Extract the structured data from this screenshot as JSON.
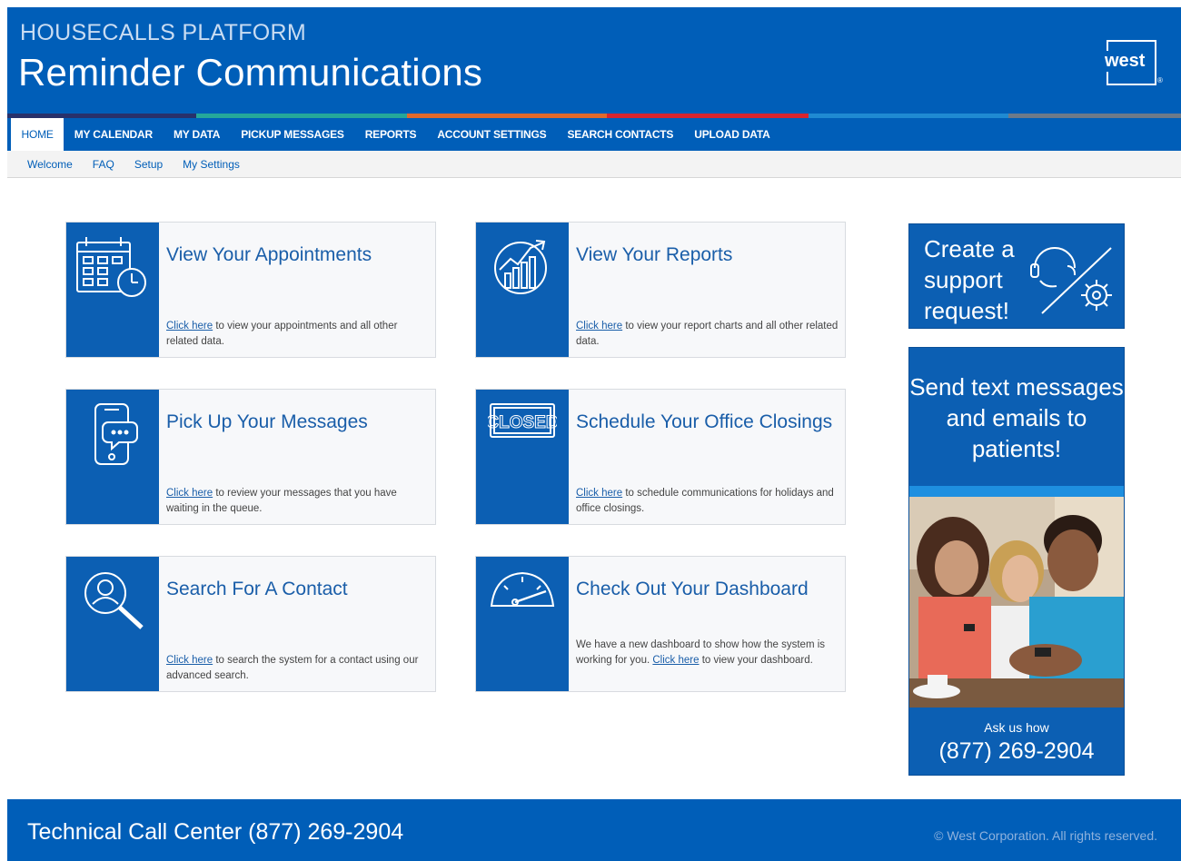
{
  "header": {
    "platform": "HOUSECALLS PLATFORM",
    "title": "Reminder Communications",
    "logo_text": "west",
    "logo_reg": "®"
  },
  "colors": {
    "brand_blue": "#005eb8",
    "card_blue": "#0c5fb3",
    "stripe": [
      "#28316b",
      "#25a79a",
      "#e1692c",
      "#d8252e",
      "#1f8ad2",
      "#6d7a89"
    ]
  },
  "nav": {
    "tabs": [
      "HOME",
      "MY CALENDAR",
      "MY DATA",
      "PICKUP MESSAGES",
      "REPORTS",
      "ACCOUNT SETTINGS",
      "SEARCH CONTACTS",
      "UPLOAD DATA"
    ],
    "active": "HOME",
    "subnav": [
      "Welcome",
      "FAQ",
      "Setup",
      "My Settings"
    ]
  },
  "cards": [
    {
      "icon": "calendar-clock-icon",
      "title": "View Your Appointments",
      "link": "Click here",
      "desc": " to view your appointments and all other related data."
    },
    {
      "icon": "report-chart-icon",
      "title": "View Your Reports",
      "link": "Click here",
      "desc": " to view your report charts and all other related data."
    },
    {
      "icon": "phone-message-icon",
      "title": "Pick Up Your Messages",
      "link": "Click here",
      "desc": " to review your messages that you have waiting in the queue."
    },
    {
      "icon": "closed-sign-icon",
      "title": "Schedule Your Office Closings",
      "link": "Click here",
      "desc": " to schedule communications for holidays and office closings."
    },
    {
      "icon": "search-person-icon",
      "title": "Search For A Contact",
      "link": "Click here",
      "desc": " to search the system for a contact using our advanced search."
    },
    {
      "icon": "dashboard-gauge-icon",
      "title": "Check Out Your Dashboard",
      "desc_pre": "We have a new dashboard to show how the system is working for you. ",
      "link": "Click here",
      "desc": " to view your dashboard."
    }
  ],
  "support": {
    "text": "Create a support request!",
    "icon": "headset-gear-icon"
  },
  "promo": {
    "text": "Send text messages and emails to patients!",
    "photo": "people-with-phones-photo",
    "ask": "Ask us how",
    "phone": "(877) 269-2904"
  },
  "footer": {
    "call": "Technical Call Center (877) 269-2904",
    "copyright": "© West Corporation. All rights reserved."
  }
}
